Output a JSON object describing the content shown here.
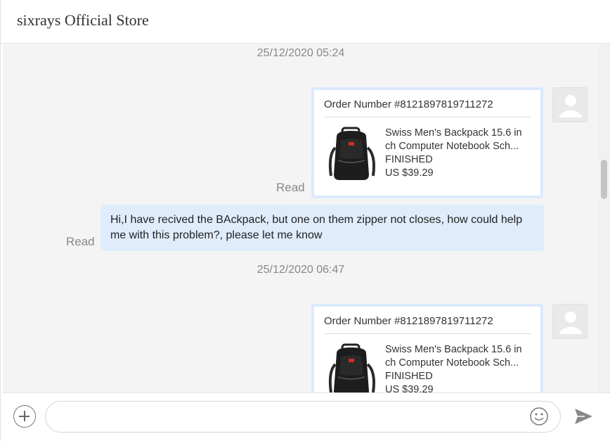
{
  "header": {
    "title": "sixrays Official Store"
  },
  "messages": [
    {
      "timestamp": "25/12/2020 05:24",
      "order_card": {
        "order_number": "Order Number #8121897819711272",
        "product_name_line1": "Swiss Men's Backpack 15.6 in",
        "product_name_line2": "ch Computer Notebook Sch...",
        "status": "FINISHED",
        "price": "US $39.29"
      },
      "read_label": "Read"
    },
    {
      "bubble_text": "Hi,I have recived the BAckpack, but one on them zipper not closes, how could help me with this problem?, please let me know",
      "read_label": "Read"
    },
    {
      "timestamp": "25/12/2020 06:47",
      "order_card": {
        "order_number": "Order Number #8121897819711272",
        "product_name_line1": "Swiss Men's Backpack 15.6 in",
        "product_name_line2": "ch Computer Notebook Sch...",
        "status": "FINISHED",
        "price": "US $39.29"
      }
    }
  ],
  "composer": {
    "placeholder": "",
    "icons": {
      "add": "plus-circle-icon",
      "emoji": "smiley-icon",
      "send": "send-arrow-icon"
    }
  },
  "colors": {
    "bubble_bg": "#dfecfb",
    "card_border": "#dbeafc",
    "muted_text": "#888888"
  }
}
